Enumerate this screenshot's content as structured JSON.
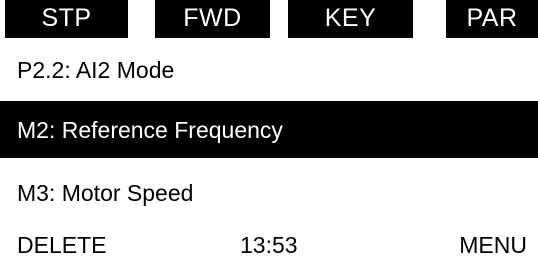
{
  "status_bar": {
    "tabs": [
      {
        "label": "STP"
      },
      {
        "label": "FWD"
      },
      {
        "label": "KEY"
      },
      {
        "label": "PAR"
      }
    ]
  },
  "menu": {
    "items": [
      {
        "label": "P2.2: AI2 Mode",
        "selected": false
      },
      {
        "label": "M2: Reference Frequency",
        "selected": true
      },
      {
        "label": "M3: Motor Speed",
        "selected": false
      }
    ]
  },
  "softkeys": {
    "left_label": "DELETE",
    "clock": "13:53",
    "right_label": "MENU"
  }
}
